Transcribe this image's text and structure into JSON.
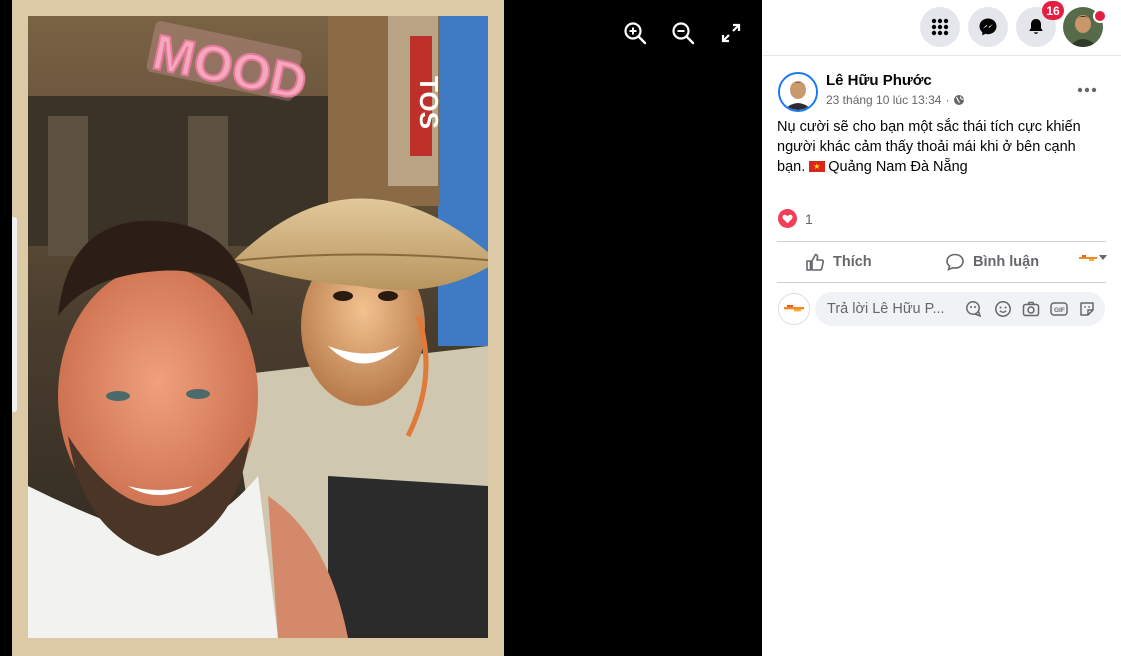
{
  "photo": {
    "sticker_text": "MOOD",
    "sign_text": "TOS"
  },
  "viewer_tools": {
    "zoom_in_icon": "zoom-in-icon",
    "zoom_out_icon": "zoom-out-icon",
    "fullscreen_icon": "expand-icon"
  },
  "topbar": {
    "menu_icon": "grid-icon",
    "messenger_icon": "messenger-icon",
    "notifications_icon": "bell-icon",
    "notifications_count": "16",
    "profile": "avatar"
  },
  "post": {
    "author": "Lê Hữu Phước",
    "timestamp": "23 tháng 10 lúc 13:34",
    "separator": "·",
    "privacy_icon": "globe-icon",
    "text": "Nụ cười sẽ cho bạn một sắc thái tích cực khiến người khác cảm thấy thoải mái khi ở bên cạnh bạn.",
    "location": "Quảng Nam Đà Nẵng",
    "reaction_count": "1",
    "reaction_icon": "heart-icon"
  },
  "actions": {
    "like_label": "Thích",
    "comment_label": "Bình luận"
  },
  "reply": {
    "placeholder": "Trả lời Lê Hữu P..."
  },
  "colors": {
    "accent": "#1877f2",
    "badge": "#e41e3f",
    "heart": "#f33e58",
    "text_secondary": "#65676b"
  }
}
